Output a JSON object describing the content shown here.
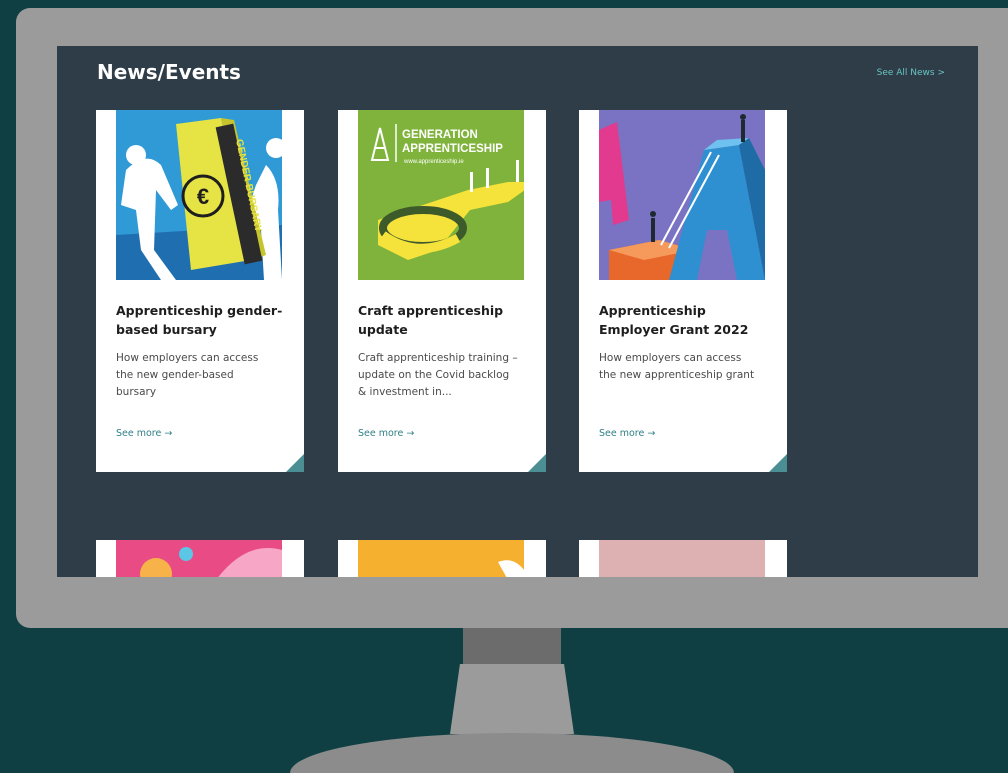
{
  "section": {
    "title": "News/Events",
    "see_all": "See All News >"
  },
  "cards": [
    {
      "title": "Apprenticeship gender-based bursary",
      "description": "How employers can access the new gender-based bursary",
      "link": "See more →",
      "art_text": "GENDER BURSARY",
      "art_symbol": "€"
    },
    {
      "title": "Craft apprenticeship update",
      "description": "Craft apprenticeship training – update on the Covid backlog & investment in...",
      "link": "See more →",
      "art_heading_1": "GENERATION",
      "art_heading_2": "APPRENTICESHIP",
      "art_url": "www.apprenticeship.ie"
    },
    {
      "title": "Apprenticeship Employer Grant 2022",
      "description": "How employers can access the new apprenticeship grant",
      "link": "See more →"
    }
  ],
  "colors": {
    "background": "#0f3f42",
    "screen": "#2e3d47",
    "accent": "#69c3c2",
    "link": "#2f7f86",
    "card_corner": "#4b8f94"
  }
}
